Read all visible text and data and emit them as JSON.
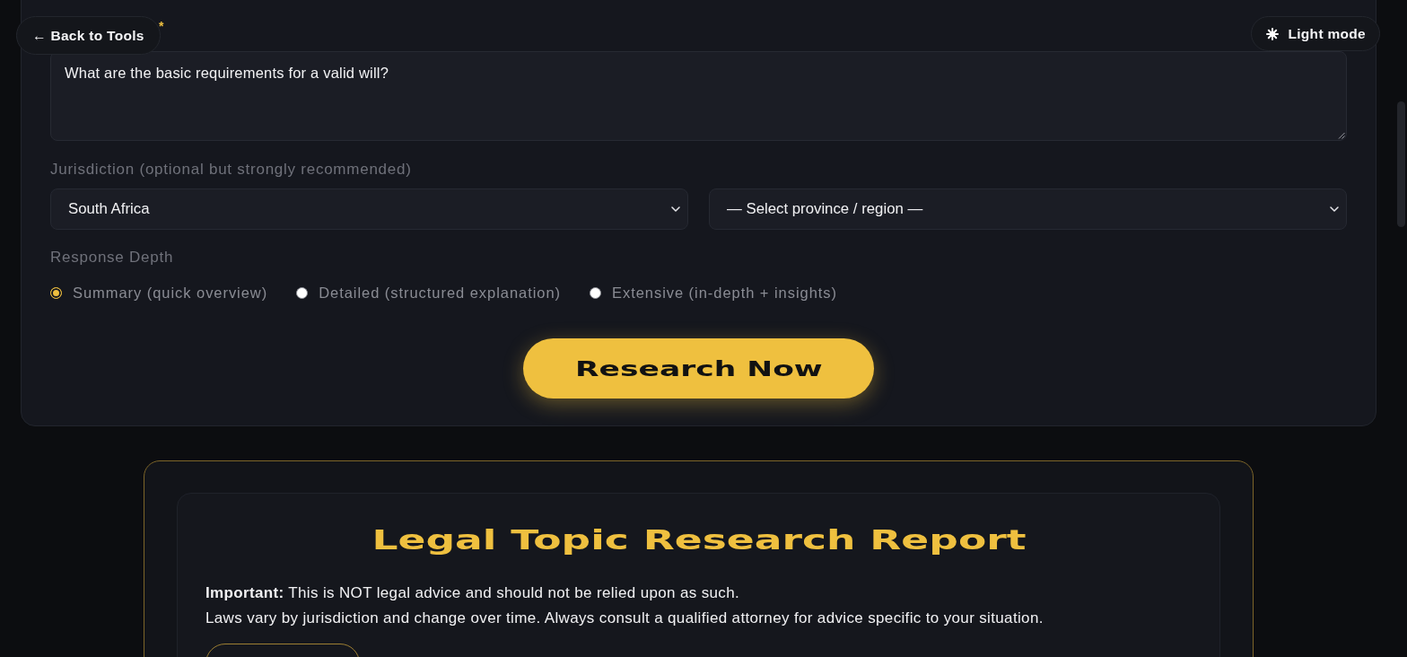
{
  "nav": {
    "back_label": "← Back to Tools",
    "theme_toggle_label": "Light mode"
  },
  "question": {
    "required_mark": "*",
    "value": "What are the basic requirements for a valid will?"
  },
  "jurisdiction": {
    "label": "Jurisdiction (optional but strongly recommended)",
    "country": {
      "value": "South Africa"
    },
    "region": {
      "value": "— Select province / region —"
    }
  },
  "depth": {
    "label": "Response Depth",
    "options": [
      {
        "label": "Summary (quick overview)",
        "selected": true
      },
      {
        "label": "Detailed (structured explanation)",
        "selected": false
      },
      {
        "label": "Extensive (in-depth + insights)",
        "selected": false
      }
    ]
  },
  "submit_button": "Research Now",
  "report": {
    "title": "Legal Topic Research Report",
    "disclaimer": [
      "**Important:** This is NOT legal advice and should not be relied upon as such.",
      "Laws vary by jurisdiction and change over time. Always consult a qualified attorney for advice specific to your situation."
    ]
  }
}
